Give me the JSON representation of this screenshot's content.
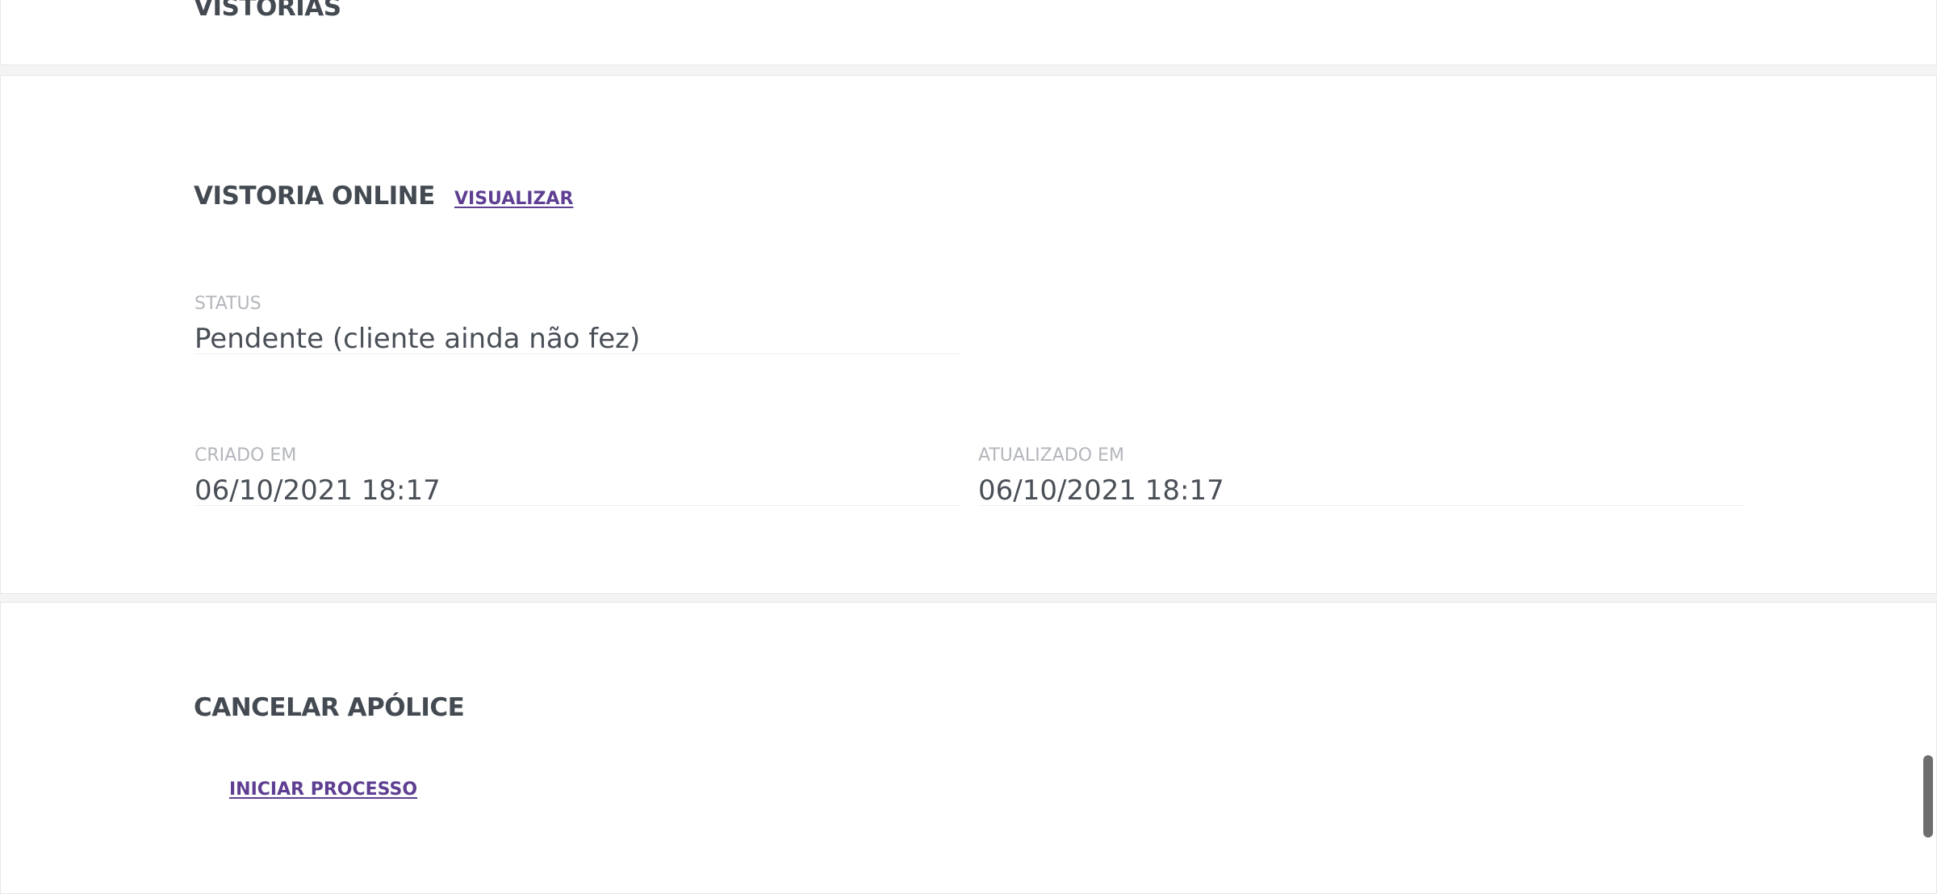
{
  "sections": {
    "vistorias": {
      "title": "VISTORIAS"
    },
    "vistoria_online": {
      "title": "VISTORIA ONLINE",
      "view_link": "VISUALIZAR",
      "status": {
        "label": "STATUS",
        "value": "Pendente (cliente ainda não fez)"
      },
      "created": {
        "label": "CRIADO EM",
        "value": "06/10/2021 18:17"
      },
      "updated": {
        "label": "ATUALIZADO EM",
        "value": "06/10/2021 18:17"
      }
    },
    "cancelar_apolice": {
      "title": "CANCELAR APÓLICE",
      "start_link": "INICIAR PROCESSO"
    }
  },
  "colors": {
    "link": "#5e3f92",
    "heading": "#444a52",
    "label": "#b3b6bb",
    "value": "#4a4f57",
    "page_background": "#f4f4f5"
  }
}
